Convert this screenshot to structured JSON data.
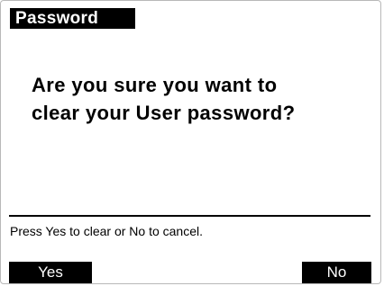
{
  "dialog": {
    "title": "Password",
    "question_line1": "Are you sure you want to",
    "question_line2": "clear your User password?",
    "hint": "Press Yes to clear or No to cancel."
  },
  "softkeys": {
    "left_label": "Yes",
    "right_label": "No"
  },
  "colors": {
    "background": "#ffffff",
    "foreground": "#000000",
    "inverse_text": "#ffffff"
  }
}
